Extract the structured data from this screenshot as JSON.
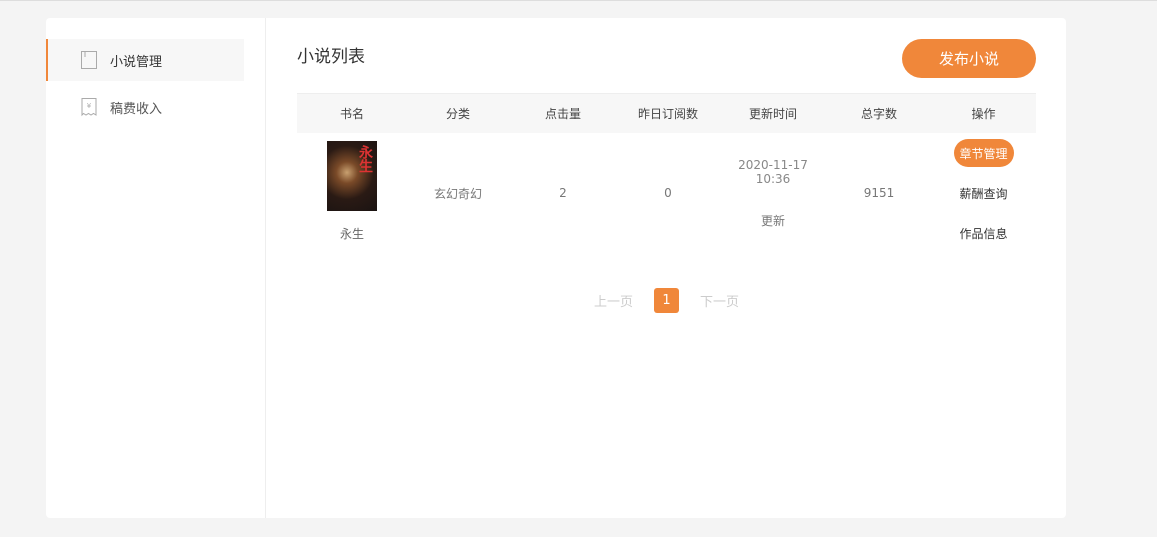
{
  "sidebar": {
    "items": [
      {
        "label": "小说管理",
        "icon": "book-icon",
        "active": true
      },
      {
        "label": "稿费收入",
        "icon": "receipt-yen-icon",
        "active": false
      }
    ]
  },
  "main": {
    "title": "小说列表",
    "publish_label": "发布小说",
    "table": {
      "headers": [
        "书名",
        "分类",
        "点击量",
        "昨日订阅数",
        "更新时间",
        "总字数",
        "操作"
      ],
      "rows": [
        {
          "cover_text": "永生",
          "name": "永生",
          "category": "玄幻奇幻",
          "clicks": "2",
          "yesterday_subs": "0",
          "update_time": "2020-11-17 10:36",
          "update_label": "更新",
          "word_count": "9151",
          "ops": {
            "chapter_manage": "章节管理",
            "salary_query": "薪酬查询",
            "work_info": "作品信息"
          }
        }
      ]
    },
    "pager": {
      "prev": "上一页",
      "current": "1",
      "next": "下一页"
    }
  },
  "colors": {
    "accent": "#f0873a"
  }
}
